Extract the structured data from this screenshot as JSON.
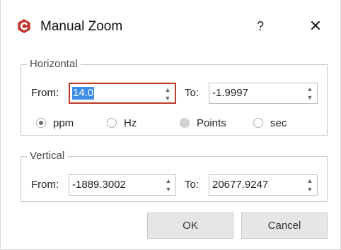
{
  "window": {
    "title": "Manual Zoom",
    "help_label": "?",
    "close_label": "✕",
    "icon": "app-logo-icon",
    "accent_color": "#c0392b"
  },
  "horizontal": {
    "legend": "Horizontal",
    "from_label": "From:",
    "from_value": "14.0",
    "to_label": "To:",
    "to_value": "-1.9997",
    "units": [
      {
        "label": "ppm",
        "checked": true,
        "enabled": true
      },
      {
        "label": "Hz",
        "checked": false,
        "enabled": true
      },
      {
        "label": "Points",
        "checked": false,
        "enabled": false
      },
      {
        "label": "sec",
        "checked": false,
        "enabled": true
      }
    ]
  },
  "vertical": {
    "legend": "Vertical",
    "from_label": "From:",
    "from_value": "-1889.3002",
    "to_label": "To:",
    "to_value": "20677.9247"
  },
  "buttons": {
    "ok": "OK",
    "cancel": "Cancel"
  },
  "icons": {
    "spin_up": "▲",
    "spin_down": "▼"
  }
}
